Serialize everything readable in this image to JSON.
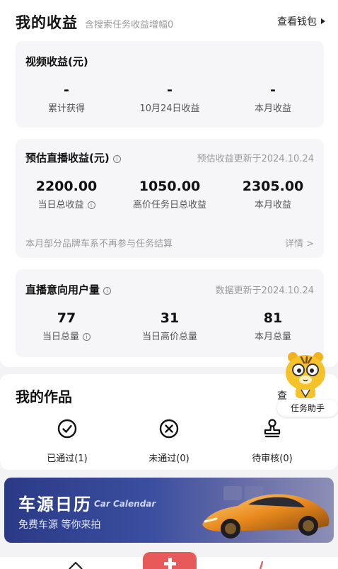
{
  "header": {
    "title": "我的收益",
    "subtitle": "含搜索任务收益增幅0",
    "wallet_label": "查看钱包"
  },
  "video_card": {
    "title": "视频收益(元)",
    "stats": [
      {
        "value": "-",
        "label": "累计获得"
      },
      {
        "value": "-",
        "label": "10月24日收益"
      },
      {
        "value": "-",
        "label": "本月收益"
      }
    ]
  },
  "live_card": {
    "title": "预估直播收益(元)",
    "update_note": "预估收益更新于2024.10.24",
    "stats": [
      {
        "value": "2200.00",
        "label": "当日总收益"
      },
      {
        "value": "1050.00",
        "label": "高价任务日总收益"
      },
      {
        "value": "2305.00",
        "label": "本月收益"
      }
    ],
    "footer_text": "本月部分品牌车系不再参与任务结算",
    "detail_label": "详情 >"
  },
  "intent_card": {
    "title": "直播意向用户量",
    "update_note": "数据更新于2024.10.24",
    "stats": [
      {
        "value": "77",
        "label": "当日总量"
      },
      {
        "value": "31",
        "label": "当日高价总量"
      },
      {
        "value": "81",
        "label": "本月总量"
      }
    ]
  },
  "works": {
    "title": "我的作品",
    "more_label": "查",
    "items": [
      {
        "icon": "check-circle-icon",
        "label": "已通过(1)"
      },
      {
        "icon": "x-circle-icon",
        "label": "未通过(0)"
      },
      {
        "icon": "stamp-icon",
        "label": "待审核(0)"
      }
    ]
  },
  "helper": {
    "label": "任务助手"
  },
  "banner": {
    "title": "车源日历",
    "title_en": "Car Calendar",
    "subtitle": "免费车源 等你来拍"
  },
  "colors": {
    "accent": "#e85a5a",
    "banner": "#2a3a86"
  }
}
